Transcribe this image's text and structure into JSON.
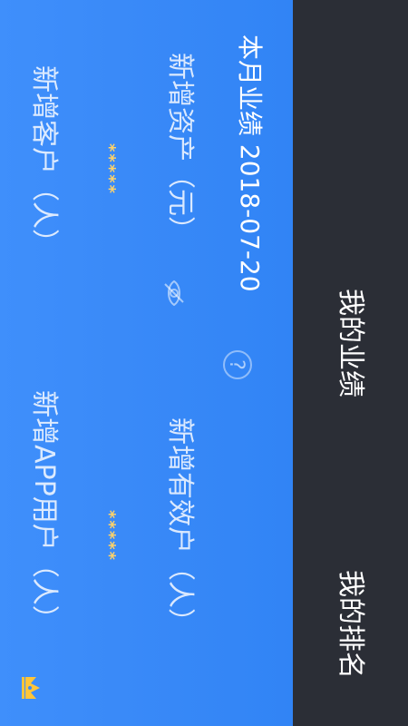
{
  "header": {
    "tab_performance": "我的业绩",
    "tab_ranking": "我的排名"
  },
  "card": {
    "title": "本月业绩 2018-07-20",
    "help_icon_glyph": "?",
    "metrics": {
      "new_assets_label": "新增资产（元）",
      "new_valid_label": "新增有效户（人）",
      "new_customers_label": "新增客户（人）",
      "new_customers_value": "*****",
      "new_app_users_label": "新增APP用户（人）",
      "new_app_users_value": "*****"
    },
    "icons": {
      "visibility": "eye-off-icon",
      "rank_badge": "crown-icon"
    }
  },
  "colors": {
    "header_bg": "#2b2e36",
    "card_bg": "#3a8af8",
    "value_color": "#ffd36a",
    "crown_color": "#ffc53a"
  }
}
